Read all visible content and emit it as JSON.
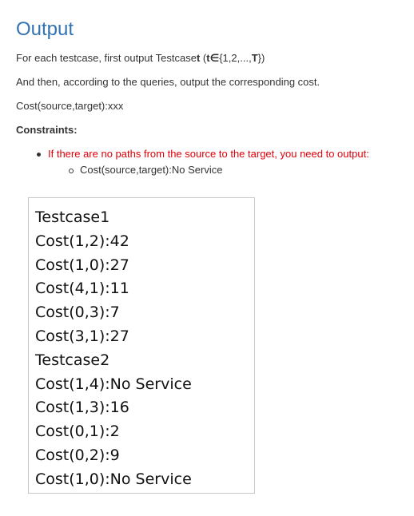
{
  "heading": "Output",
  "para1": {
    "text": "For each testcase, first output Testcase",
    "bold_t": "t",
    "set_open": " (",
    "element_of": "t∈",
    "set_body": "{1,2,...,",
    "bold_T": "T",
    "set_close": "})"
  },
  "para2": "And then, according to the queries, output the corresponding cost.",
  "para3": "Cost(source,target):xxx",
  "para4": "Constraints:",
  "bullet1": "If there are no paths from the source to the target, you need to output:",
  "bullet2": "Cost(source,target):No Service",
  "colors": {
    "heading": "#3273b3",
    "warning": "#e0000a",
    "text": "#333333"
  },
  "output_lines": [
    "Testcase1",
    "Cost(1,2):42",
    "Cost(1,0):27",
    "Cost(4,1):11",
    "Cost(0,3):7",
    "Cost(3,1):27",
    "Testcase2",
    "Cost(1,4):No Service",
    "Cost(1,3):16",
    "Cost(0,1):2",
    "Cost(0,2):9",
    "Cost(1,0):No Service"
  ]
}
